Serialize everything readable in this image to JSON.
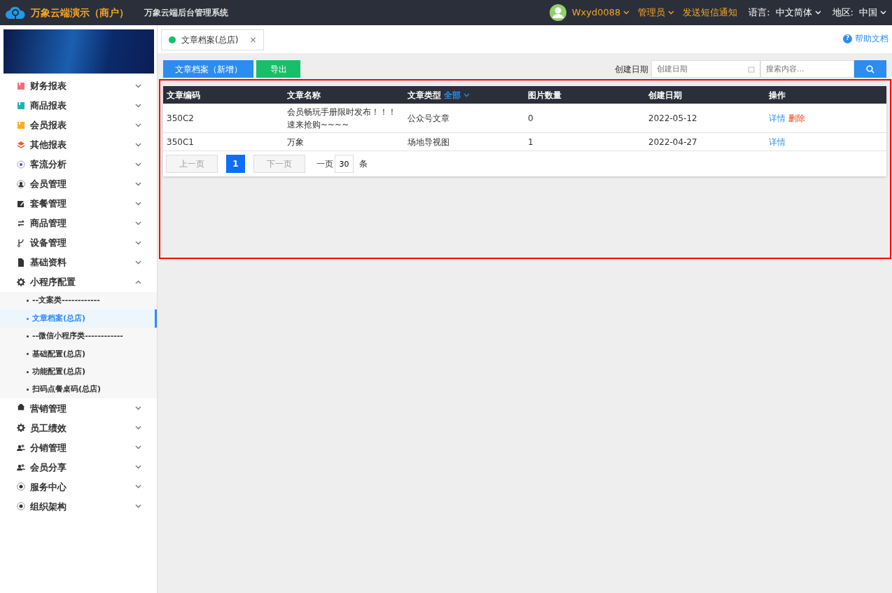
{
  "header": {
    "brand": "万象云端演示（商户）",
    "subtitle": "万象云端后台管理系统",
    "user": "Wxyd0088",
    "role": "管理员",
    "notice": "发送短信通知",
    "language_label": "语言:",
    "language": "中文简体",
    "region_label": "地区:",
    "region": "中国"
  },
  "sidebar": {
    "items": [
      {
        "label": "财务报表",
        "expanded": false
      },
      {
        "label": "商品报表",
        "expanded": false
      },
      {
        "label": "会员报表",
        "expanded": false
      },
      {
        "label": "其他报表",
        "expanded": false
      },
      {
        "label": "客流分析",
        "expanded": false
      },
      {
        "label": "会员管理",
        "expanded": false
      },
      {
        "label": "套餐管理",
        "expanded": false
      },
      {
        "label": "商品管理",
        "expanded": false
      },
      {
        "label": "设备管理",
        "expanded": false
      },
      {
        "label": "基础资料",
        "expanded": false
      },
      {
        "label": "小程序配置",
        "expanded": true,
        "children": [
          {
            "label": "--文案类------------",
            "selected": false
          },
          {
            "label": "文章档案(总店)",
            "selected": true
          },
          {
            "label": "--微信小程序类------------",
            "selected": false
          },
          {
            "label": "基础配置(总店)",
            "selected": false
          },
          {
            "label": "功能配置(总店)",
            "selected": false
          },
          {
            "label": "扫码点餐桌码(总店)",
            "selected": false
          }
        ]
      },
      {
        "label": "营销管理",
        "expanded": false
      },
      {
        "label": "员工绩效",
        "expanded": false
      },
      {
        "label": "分销管理",
        "expanded": false
      },
      {
        "label": "会员分享",
        "expanded": false
      },
      {
        "label": "服务中心",
        "expanded": false
      },
      {
        "label": "组织架构",
        "expanded": false
      }
    ]
  },
  "tabs": [
    {
      "label": "文章档案(总店)",
      "selected": true,
      "close": "×"
    }
  ],
  "help": "帮助文档",
  "help_mark": "?",
  "toolbar": {
    "buttons": [
      {
        "label": "文章档案（新增）",
        "kind": "primary"
      },
      {
        "label": "导出",
        "kind": "success"
      }
    ],
    "date_label": "创建日期",
    "date_placeholder": "创建日期",
    "search_placeholder": "搜索内容..."
  },
  "table": {
    "columns": [
      "文章编码",
      "文章名称",
      "文章类型",
      "图片数量",
      "创建日期",
      "操作"
    ],
    "type_filter": "全部",
    "rows": [
      {
        "cells": [
          "350C2",
          "会员畅玩手册限时发布！！！速来抢购~~~~",
          "公众号文章",
          "0",
          "2022-05-12"
        ],
        "actions": [
          "详情",
          "删除"
        ]
      },
      {
        "cells": [
          "350C1",
          "万象",
          "场地导视图",
          "1",
          "2022-04-27"
        ],
        "actions": [
          "详情"
        ]
      }
    ]
  },
  "pagination": {
    "prev": "上一页",
    "pages": [
      {
        "label": "1",
        "selected": true
      }
    ],
    "next": "下一页",
    "per_page_label": "一页",
    "per_page": "30",
    "unit": "条"
  }
}
